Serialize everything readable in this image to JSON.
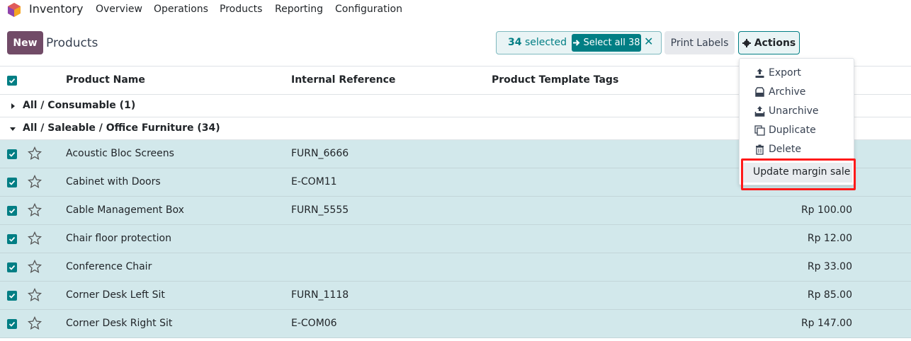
{
  "app": {
    "name": "Inventory"
  },
  "nav": {
    "items": [
      "Overview",
      "Operations",
      "Products",
      "Reporting",
      "Configuration"
    ]
  },
  "control": {
    "new_label": "New",
    "title": "Products",
    "selected_count": "34",
    "selected_suffix": "selected",
    "select_all_label": "Select all 38",
    "print_label": "Print Labels",
    "actions_label": "Actions"
  },
  "table": {
    "headers": {
      "name": "Product Name",
      "ref": "Internal Reference",
      "tags": "Product Template Tags"
    },
    "groups": [
      {
        "label": "All / Consumable (1)",
        "expanded": false
      },
      {
        "label": "All / Saleable / Office Furniture (34)",
        "expanded": true
      }
    ],
    "rows": [
      {
        "name": "Acoustic Bloc Screens",
        "ref": "FURN_6666",
        "price": ""
      },
      {
        "name": "Cabinet with Doors",
        "ref": "E-COM11",
        "price": ""
      },
      {
        "name": "Cable Management Box",
        "ref": "FURN_5555",
        "price": "Rp 100.00"
      },
      {
        "name": "Chair floor protection",
        "ref": "",
        "price": "Rp 12.00"
      },
      {
        "name": "Conference Chair",
        "ref": "",
        "price": "Rp 33.00"
      },
      {
        "name": "Corner Desk Left Sit",
        "ref": "FURN_1118",
        "price": "Rp 85.00"
      },
      {
        "name": "Corner Desk Right Sit",
        "ref": "E-COM06",
        "price": "Rp 147.00"
      }
    ]
  },
  "actions_menu": {
    "items": [
      {
        "label": "Export",
        "icon": "upload-icon"
      },
      {
        "label": "Archive",
        "icon": "archive-icon"
      },
      {
        "label": "Unarchive",
        "icon": "unarchive-icon"
      },
      {
        "label": "Duplicate",
        "icon": "copy-icon"
      },
      {
        "label": "Delete",
        "icon": "trash-icon"
      }
    ],
    "custom_item": "Update margin sale"
  },
  "colors": {
    "brand": "#714B67",
    "accent": "#017e84",
    "selected_row": "#d2e8eb",
    "highlight": "#ff1a1a"
  }
}
